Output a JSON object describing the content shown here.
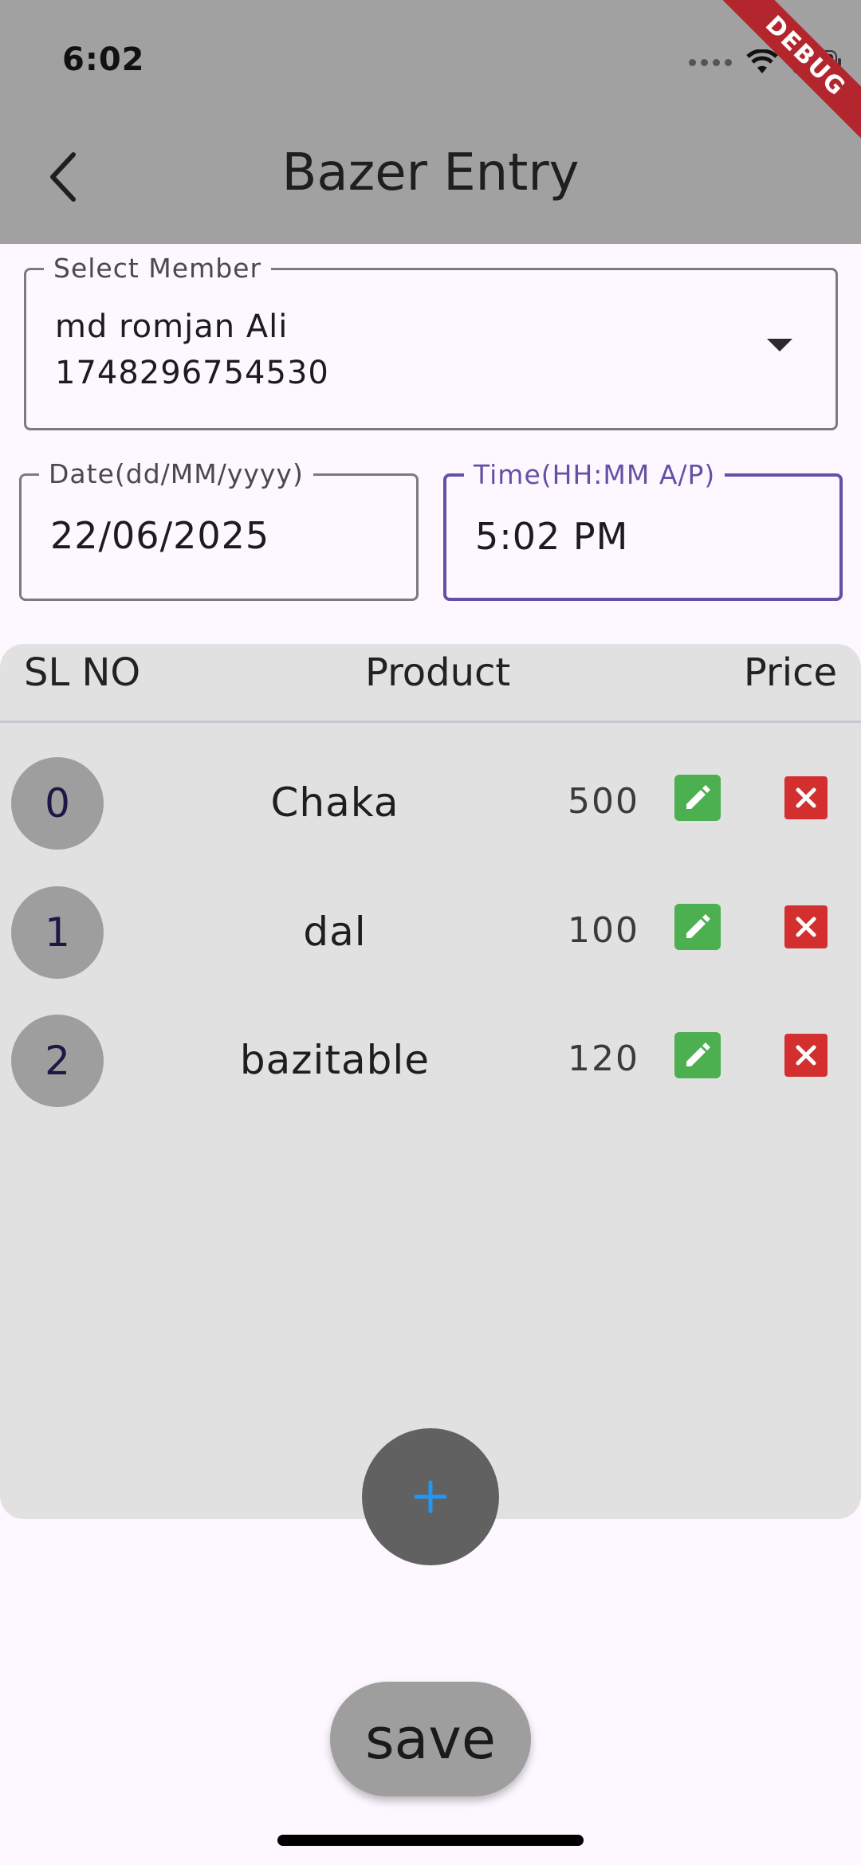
{
  "status_bar": {
    "time": "6:02",
    "debug_label": "DEBUG"
  },
  "app_bar": {
    "title": "Bazer Entry",
    "back_icon": "chevron-left-icon"
  },
  "member_select": {
    "label": "Select Member",
    "name": "md romjan Ali",
    "id": "1748296754530",
    "arrow_icon": "dropdown-arrow-icon"
  },
  "date_field": {
    "label": "Date(dd/MM/yyyy)",
    "value": "22/06/2025"
  },
  "time_field": {
    "label": "Time(HH:MM A/P)",
    "value": "5:02 PM"
  },
  "table": {
    "headers": {
      "sl": "SL NO",
      "product": "Product",
      "price": "Price"
    },
    "rows": [
      {
        "sl": "0",
        "product": "Chaka",
        "price": "500"
      },
      {
        "sl": "1",
        "product": "dal",
        "price": "100"
      },
      {
        "sl": "2",
        "product": "bazitable",
        "price": "120"
      }
    ]
  },
  "fab": {
    "icon": "plus-icon",
    "icon_color": "#2196f3"
  },
  "save_button": {
    "label": "save"
  },
  "colors": {
    "app_bar": "#a1a1a1",
    "background": "#fdf7ff",
    "focus_accent": "#6750a4",
    "edit_green": "#4caf50",
    "delete_red": "#d32f2f"
  }
}
